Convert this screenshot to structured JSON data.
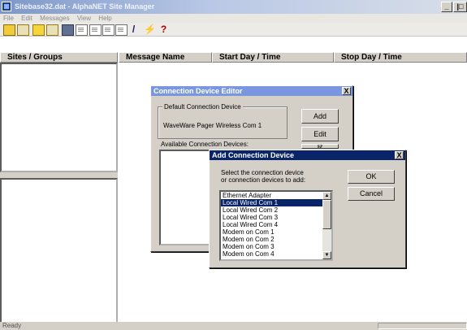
{
  "window": {
    "title": "Sitebase32.dat - AlphaNET Site Manager",
    "min_glyph": "_",
    "close_glyph": "|□"
  },
  "menu": [
    "File",
    "Edit",
    "Messages",
    "View",
    "Help"
  ],
  "toolbar": {
    "icons": [
      "open-folder-icon",
      "open-file-icon",
      "folder-icon",
      "open-file-icon",
      "save-icon",
      "document-icon",
      "document-icon",
      "document-icon",
      "document-icon",
      "pencil-icon",
      "flag-icon",
      "help-icon"
    ],
    "pencil_glyph": "/",
    "flag_glyph": "⚡",
    "help_glyph": "?"
  },
  "left_pane": {
    "header": "Sites / Groups"
  },
  "columns": [
    "Message Name",
    "Start Day / Time",
    "Stop Day / Time"
  ],
  "status": {
    "text": "Ready"
  },
  "connection_editor": {
    "title": "Connection Device Editor",
    "default_group": "Default Connection Device",
    "default_value": "WaveWare Pager Wireless Com 1",
    "add_label": "Add",
    "edit_label": "Edit",
    "partial_button": "R",
    "available_label": "Available Connection Devices:",
    "close_glyph": "X"
  },
  "add_device": {
    "title": "Add Connection Device",
    "instruction_line1": "Select the connection device",
    "instruction_line2": "or connection devices to add:",
    "ok_label": "OK",
    "cancel_label": "Cancel",
    "close_glyph": "X",
    "scroll_up": "▲",
    "scroll_down": "▼",
    "devices": [
      {
        "label": "Ethernet Adapter",
        "selected": false
      },
      {
        "label": "Local Wired Com 1",
        "selected": true
      },
      {
        "label": "Local Wired Com 2",
        "selected": false
      },
      {
        "label": "Local Wired Com 3",
        "selected": false
      },
      {
        "label": "Local Wired Com 4",
        "selected": false
      },
      {
        "label": "Modem on Com 1",
        "selected": false
      },
      {
        "label": "Modem on Com 2",
        "selected": false
      },
      {
        "label": "Modem on Com 3",
        "selected": false
      },
      {
        "label": "Modem on Com 4",
        "selected": false
      }
    ]
  },
  "colors": {
    "title_active": "#0a246a",
    "title_inactive": "#7a96df",
    "selection": "#0a246a"
  }
}
